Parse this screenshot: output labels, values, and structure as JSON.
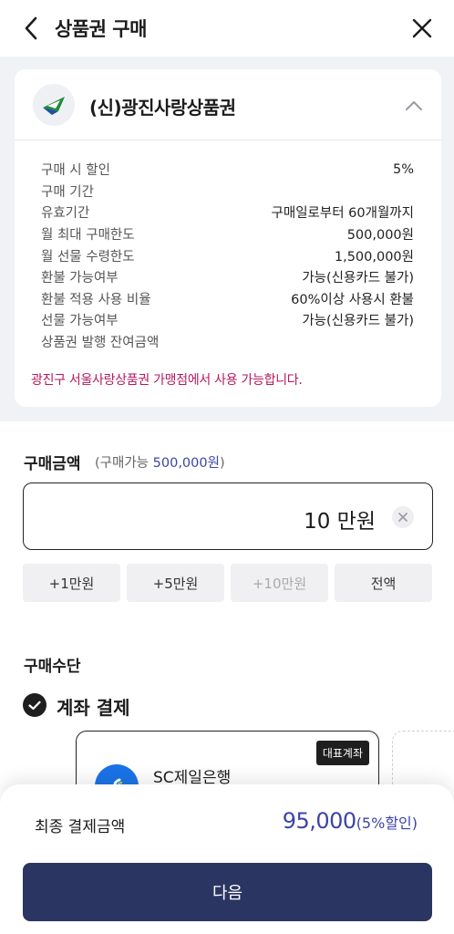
{
  "header": {
    "title": "상품권 구매"
  },
  "voucher": {
    "name": "(신)광진사랑상품권",
    "details": [
      {
        "label": "구매 시 할인",
        "value": "5%"
      },
      {
        "label": "구매 기간",
        "value": ""
      },
      {
        "label": "유효기간",
        "value": "구매일로부터 60개월까지"
      },
      {
        "label": "월 최대 구매한도",
        "value": "500,000원"
      },
      {
        "label": "월 선물 수령한도",
        "value": "1,500,000원"
      },
      {
        "label": "환불 가능여부",
        "value": "가능(신용카드 불가)"
      },
      {
        "label": "환불 적용 사용 비율",
        "value": "60%이상 사용시 환불"
      },
      {
        "label": "선물 가능여부",
        "value": "가능(신용카드 불가)"
      },
      {
        "label": "상품권 발행 잔여금액",
        "value": ""
      }
    ],
    "notice": "광진구 서울사랑상품권 가맹점에서 사용 가능합니다."
  },
  "amount": {
    "title": "구매금액",
    "sub_prefix": "(구매가능 ",
    "sub_limit": "500,000원",
    "sub_suffix": ")",
    "value": "10 만원",
    "quick_buttons": [
      "+1만원",
      "+5만원",
      "+10만원",
      "전액"
    ]
  },
  "payment": {
    "title": "구매수단",
    "method": "계좌 결제",
    "account": {
      "badge": "대표계좌",
      "bank_name": "SC제일은행"
    }
  },
  "summary": {
    "label": "최종 결제금액",
    "amount": "95,000",
    "discount_note": "(5%할인)",
    "next_label": "다음"
  },
  "colors": {
    "accent": "#3c44a6",
    "notice": "#b2195f",
    "primary_button": "#2b3562",
    "bank": "#1b73e8"
  }
}
